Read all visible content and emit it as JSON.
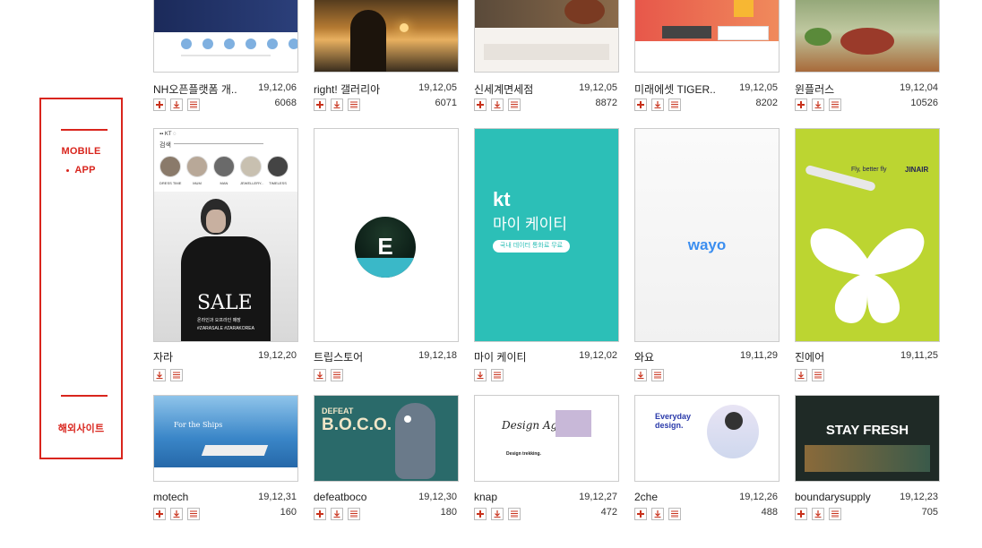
{
  "sidebar": {
    "mobile_label": "MOBILE",
    "app_label": "APP",
    "overseas_label": "해외사이트"
  },
  "colors": {
    "accent": "#d9251d",
    "icon_red": "#c8321c"
  },
  "rows": [
    [
      {
        "title": "NH오픈플랫폼 개..",
        "date": "19,12,06",
        "count": "6068",
        "add": true,
        "thumb": "nh-developers"
      },
      {
        "title": "right! 갤러리아",
        "date": "19,12,05",
        "count": "6071",
        "add": true,
        "thumb": "sunset-silhouette"
      },
      {
        "title": "신세계면세점",
        "date": "19,12,05",
        "count": "8872",
        "add": true,
        "thumb": "duty-free"
      },
      {
        "title": "미래에셋 TIGER..",
        "date": "19,12,05",
        "count": "8202",
        "add": true,
        "thumb": "tiger-etf"
      },
      {
        "title": "윈플러스",
        "date": "19,12,04",
        "count": "10526",
        "add": true,
        "thumb": "greens-market"
      }
    ],
    [
      {
        "title": "자라",
        "date": "19,12,20",
        "count": "",
        "add": false,
        "thumb": "zara-sale"
      },
      {
        "title": "트립스토어",
        "date": "19,12,18",
        "count": "",
        "add": false,
        "thumb": "tripstore-e"
      },
      {
        "title": "마이 케이티",
        "date": "19,12,02",
        "count": "",
        "add": false,
        "thumb": "my-kt"
      },
      {
        "title": "와요",
        "date": "19,11,29",
        "count": "",
        "add": false,
        "thumb": "wayo"
      },
      {
        "title": "진에어",
        "date": "19,11,25",
        "count": "",
        "add": false,
        "thumb": "jinair"
      }
    ],
    [
      {
        "title": "motech",
        "date": "19,12,31",
        "count": "160",
        "add": true,
        "thumb": "ship"
      },
      {
        "title": "defeatboco",
        "date": "19,12,30",
        "count": "180",
        "add": true,
        "thumb": "boco"
      },
      {
        "title": "knap",
        "date": "19,12,27",
        "count": "472",
        "add": true,
        "thumb": "design-agency"
      },
      {
        "title": "2che",
        "date": "19,12,26",
        "count": "488",
        "add": true,
        "thumb": "everyday-design"
      },
      {
        "title": "boundarysupply",
        "date": "19,12,23",
        "count": "705",
        "add": true,
        "thumb": "stay-fresh"
      }
    ]
  ],
  "thumb_text": {
    "zara_sale": "SALE",
    "zara_tag": "#ZARASALE #ZARAKOREA",
    "zara_sub": "온라인과 오프라인 매장",
    "zara_search": "검색",
    "zara_cats": [
      "DRESS TIME",
      "MUM",
      "MAN",
      "JEWELLERY...",
      "TIMELESS"
    ],
    "trip_letter": "E",
    "kt_logo": "kt",
    "kt_title": "마이 케이티",
    "kt_pill": "국내 데이터 통화료 무료",
    "wayo_logo": "wayo",
    "jinair_slogan": "Fly, better fly",
    "jinair_logo": "JINAIR",
    "ship_caption": "For the Ships",
    "boco_title": "B.O.C.O.",
    "boco_sub": "DEFEAT",
    "knap_title": "Design Agency",
    "knap_sub": "Design trekking.",
    "che_title": "Everyday design.",
    "stay_fresh": "STAY FRESH"
  }
}
